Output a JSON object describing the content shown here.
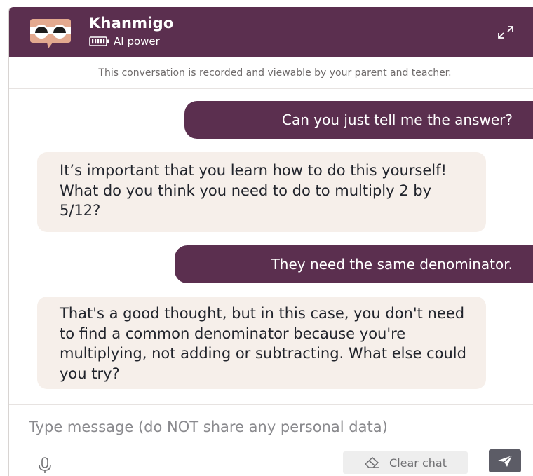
{
  "header": {
    "title": "Khanmigo",
    "subtitle": "AI power",
    "avatar_icon": "khanmigo-avatar-icon",
    "battery_icon": "battery-icon",
    "expand_icon": "expand-icon",
    "background_color": "#5b2f4f"
  },
  "notice": "This conversation is recorded and viewable by your parent and teacher.",
  "messages": [
    {
      "role": "user",
      "text": "Can you just tell me the answer?"
    },
    {
      "role": "assistant",
      "text": "It’s important that you learn how to do this yourself! What do you think you need to do to multiply 2 by 5/12?"
    },
    {
      "role": "user",
      "text": "They need the same denominator."
    },
    {
      "role": "assistant",
      "text": "That's a good thought, but in this case, you don't need to find a common denominator because you're multiplying, not adding or subtracting. What else could you try?"
    }
  ],
  "composer": {
    "placeholder": "Type message (do NOT share any personal data)",
    "value": "",
    "mic_icon": "microphone-icon",
    "clear_label": "Clear chat",
    "clear_icon": "eraser-icon",
    "send_icon": "send-icon"
  },
  "colors": {
    "accent": "#5b2f4f",
    "assistant_bubble": "#f6efea",
    "send_button": "#5c5c66"
  }
}
